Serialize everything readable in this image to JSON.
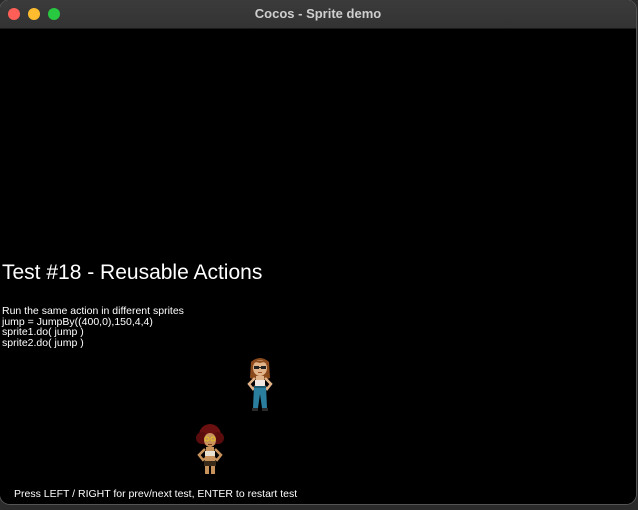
{
  "window": {
    "title": "Cocos - Sprite demo"
  },
  "scene": {
    "test_title": "Test #18 - Reusable Actions",
    "description_lines": [
      "Run the same action in different sprites",
      "jump = JumpBy((400,0),150,4,4)",
      "sprite1.do( jump )",
      "sprite2.do( jump )"
    ],
    "footer": "Press LEFT / RIGHT for prev/next test, ENTER to restart test"
  },
  "sprites": [
    {
      "name": "sprite1",
      "hair_color": "#8b4a1c",
      "outfit_color": "#2a7f9e"
    },
    {
      "name": "sprite2",
      "hair_color": "#6b1010",
      "outfit_color": "#3a2a1a"
    }
  ]
}
